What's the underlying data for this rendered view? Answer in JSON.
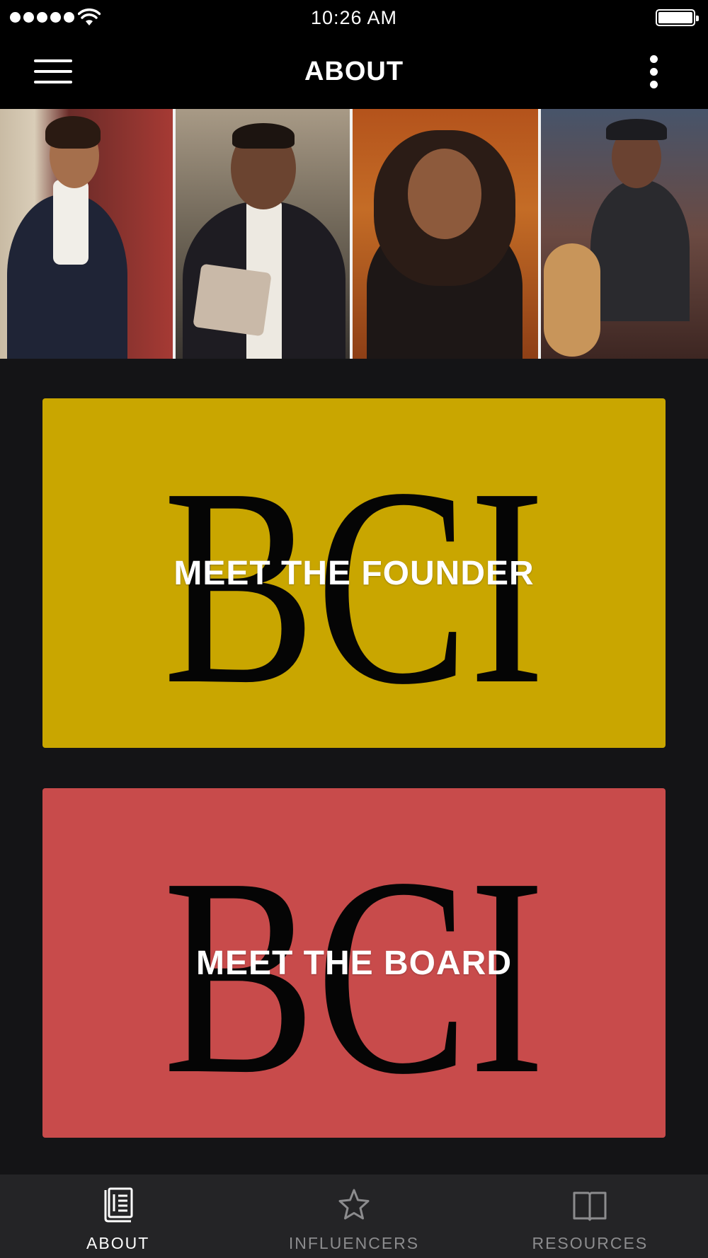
{
  "status_bar": {
    "time": "10:26 AM",
    "signal_icon": "signal-dots-icon",
    "wifi_icon": "wifi-icon",
    "battery_icon": "battery-icon",
    "battery_level": 1.0
  },
  "nav_bar": {
    "title": "ABOUT",
    "menu_icon": "hamburger-icon",
    "more_icon": "more-vertical-icon"
  },
  "photo_strip": {
    "photo_count": 4
  },
  "cards": [
    {
      "logo_text": "BCI",
      "label": "MEET THE FOUNDER",
      "color": "#c9a600"
    },
    {
      "logo_text": "BCI",
      "label": "MEET THE BOARD",
      "color": "#c84b4b"
    }
  ],
  "tab_bar": {
    "tabs": [
      {
        "label": "ABOUT",
        "icon": "book-icon",
        "active": true
      },
      {
        "label": "INFLUENCERS",
        "icon": "star-icon",
        "active": false
      },
      {
        "label": "RESOURCES",
        "icon": "open-book-icon",
        "active": false
      }
    ]
  },
  "colors": {
    "background": "#141416",
    "header": "#000000",
    "tab_bar": "#242426",
    "tab_inactive": "#8c8c8e",
    "tab_active": "#ffffff"
  }
}
